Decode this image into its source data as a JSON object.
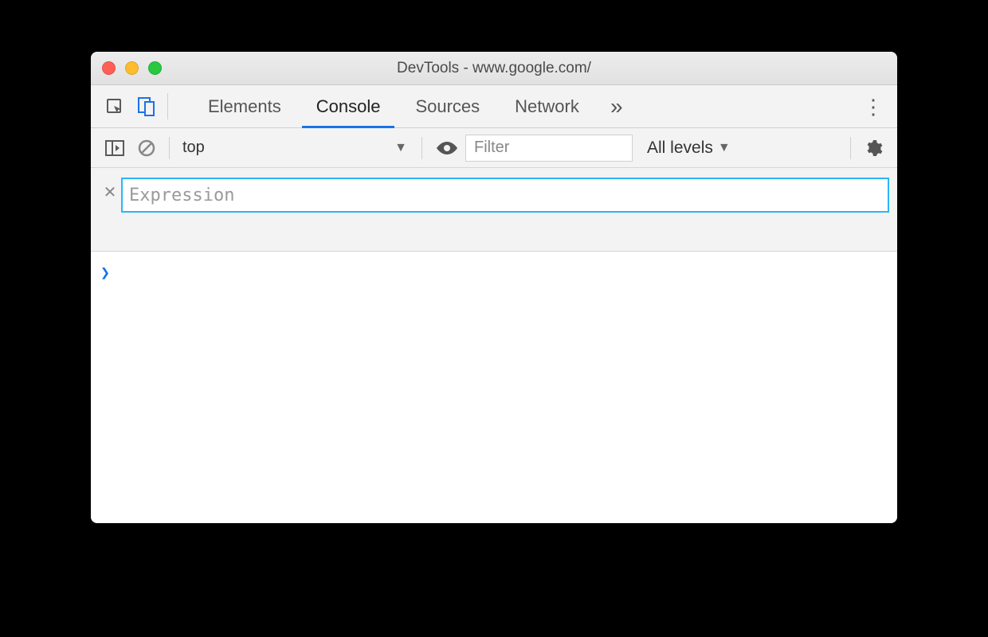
{
  "window": {
    "title": "DevTools - www.google.com/"
  },
  "tabs": {
    "items": [
      "Elements",
      "Console",
      "Sources",
      "Network"
    ],
    "active_index": 1,
    "overflow_glyph": "»"
  },
  "console_toolbar": {
    "context_label": "top",
    "filter_placeholder": "Filter",
    "levels_label": "All levels"
  },
  "live_expression": {
    "placeholder": "Expression",
    "value": ""
  },
  "console": {
    "prompt_glyph": "❯"
  }
}
